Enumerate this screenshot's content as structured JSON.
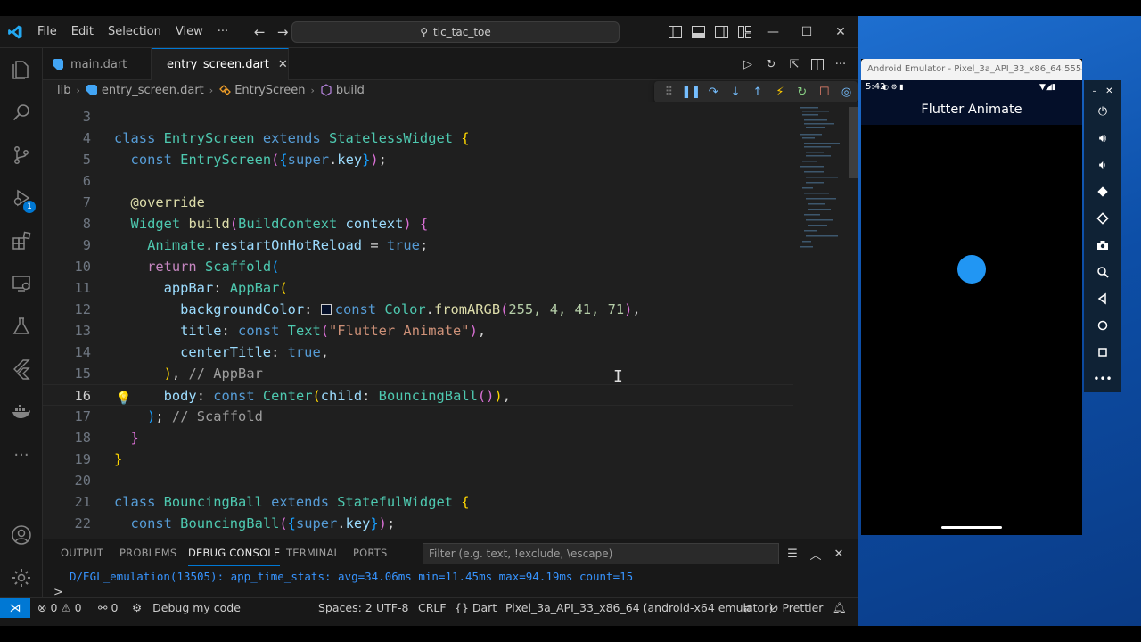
{
  "titlebar": {
    "menu": [
      "File",
      "Edit",
      "Selection",
      "View",
      "···"
    ],
    "search": "tic_tac_toe"
  },
  "tabs": [
    {
      "label": "main.dart",
      "active": false
    },
    {
      "label": "entry_screen.dart",
      "active": true
    }
  ],
  "breadcrumb": [
    "lib",
    "entry_screen.dart",
    "EntryScreen",
    "build"
  ],
  "editor": {
    "current_line": 16,
    "lines": [
      3,
      4,
      5,
      6,
      7,
      8,
      9,
      10,
      11,
      12,
      13,
      14,
      15,
      16,
      17,
      18,
      19,
      20,
      21,
      22
    ],
    "strings": {
      "title_str": "\"Flutter Animate\"",
      "argb": "255, 4, 41, 71"
    }
  },
  "panel": {
    "tabs": [
      "OUTPUT",
      "PROBLEMS",
      "DEBUG CONSOLE",
      "TERMINAL",
      "PORTS"
    ],
    "active_tab": "DEBUG CONSOLE",
    "filter_placeholder": "Filter (e.g. text, !exclude, \\escape)",
    "console_line": "D/EGL_emulation(13505): app_time_stats: avg=34.06ms min=11.45ms max=94.19ms count=15",
    "prompt": ">"
  },
  "statusbar": {
    "errors": "0",
    "warnings": "0",
    "ports": "0",
    "debug": "Debug my code",
    "spaces": "Spaces: 2",
    "encoding": "UTF-8",
    "eol": "CRLF",
    "language": "Dart",
    "device": "Pixel_3a_API_33_x86_64 (android-x64 emulator)",
    "prettier": "Prettier"
  },
  "emulator": {
    "window_title": "Android Emulator - Pixel_3a_API_33_x86_64:5554",
    "time": "5:42",
    "app_title": "Flutter Animate",
    "appbar_color": "#040f29",
    "ball_color": "#2196f3"
  },
  "colors": {
    "accent": "#0078d4",
    "editor_bg": "#1f1f1f",
    "chrome_bg": "#181818"
  }
}
